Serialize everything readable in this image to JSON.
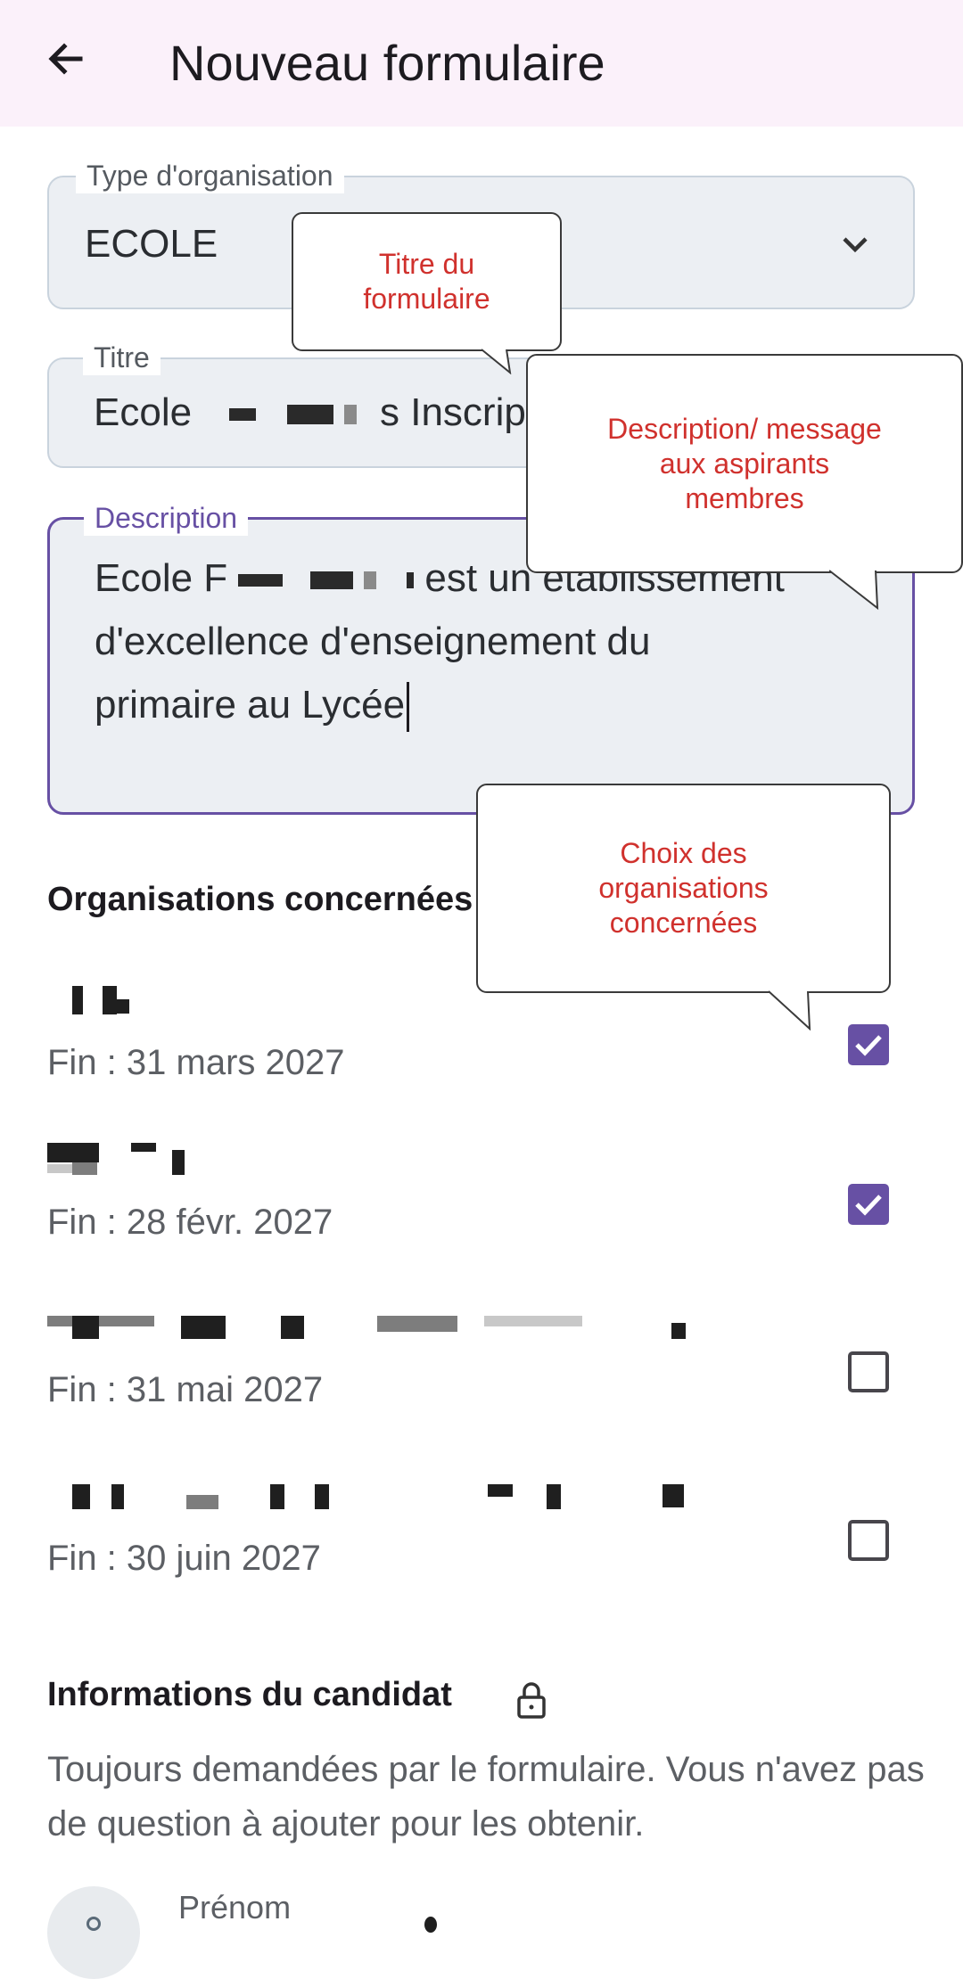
{
  "appbar": {
    "title": "Nouveau formulaire",
    "back_icon": "arrow-left-icon"
  },
  "form": {
    "type": {
      "label": "Type d'organisation",
      "value": "ECOLE"
    },
    "title": {
      "label": "Titre",
      "value_start": "Ecole",
      "value_end": "s Inscrip"
    },
    "description": {
      "label": "Description",
      "line1_start": "Ecole F",
      "line1_end": "est un établissement",
      "line2": "d'excellence d'enseignement du",
      "line3": "primaire au Lycée"
    }
  },
  "organisations": {
    "section_title": "Organisations concernées",
    "items": [
      {
        "end": "Fin : 31 mars 2027",
        "checked": true
      },
      {
        "end": "Fin : 28 févr. 2027",
        "checked": true
      },
      {
        "end": "Fin : 31 mai 2027",
        "checked": false
      },
      {
        "end": "Fin : 30 juin 2027",
        "checked": false
      }
    ]
  },
  "candidate": {
    "section_title": "Informations du candidat",
    "description": "Toujours demandées par le formulaire. Vous n'avez pas de question à ajouter pour les obtenir.",
    "first_field_label": "Prénom"
  },
  "annotations": {
    "title_tip": "Titre du formulaire",
    "description_tip": "Description/ message aux aspirants membres",
    "orgs_tip": "Choix des organisations concernées"
  },
  "colors": {
    "accent": "#6750a4",
    "annotation_text": "#d0312d",
    "appbar_bg": "#fbf1fa"
  }
}
